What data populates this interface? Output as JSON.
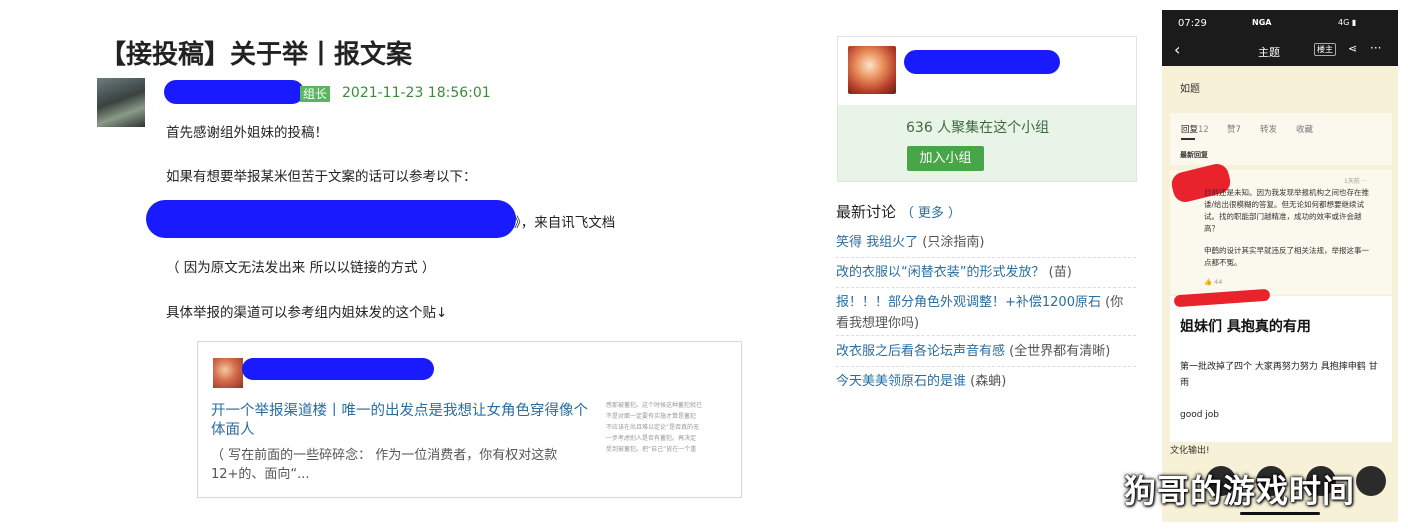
{
  "post": {
    "title": "【接投稿】关于举丨报文案",
    "badge": "组长",
    "date": "2021-11-23 18:56:01",
    "paragraphs": [
      "首先感谢组外姐妹的投稿！",
      "如果有想要举报某米但苦于文案的话可以参考以下：",
      "》，来自讯飞文档",
      "（ 因为原文无法发出来 所以以链接的方式 ）",
      "具体举报的渠道可以参考组内姐妹发的这个贴↓"
    ]
  },
  "embed": {
    "title": "开一个举报渠道楼丨唯一的出发点是我想让女角色穿得像个体面人",
    "desc": "（ 写在前面的一些碎碎念： 作为一位消费者，你有权对这款12+的、面向“...",
    "side_lines": [
      "感那被蓄犯。这个时候这种蓄犯就已",
      "不是对面一定要有实施才算是蓄犯",
      "",
      "不应该在尚且难以定论“是否真的无",
      "一步考虑别人是否有蓄犯。再决定",
      "受到被蓄犯。把“自己”放在一个重"
    ]
  },
  "group": {
    "count": "636 人聚集在这个小组",
    "join_label": "加入小组"
  },
  "discussions": {
    "heading": "最新讨论",
    "more": "（ 更多 ）",
    "items": [
      {
        "title": "笑得 我组火了",
        "author": "(只涂指南)"
      },
      {
        "title": "改的衣服以“闲替衣装”的形式发放？",
        "author": "(苗)"
      },
      {
        "title": "报！！！部分角色外观调整！+补偿1200原石",
        "author": "(你看我想理你吗)"
      },
      {
        "title": "改衣服之后看各论坛声音有感",
        "author": "(全世界都有清晰)"
      },
      {
        "title": "今天美美领原石的是谁",
        "author": "(森蚺)"
      }
    ]
  },
  "phone": {
    "time": "07:29",
    "app_badge": "NGA",
    "signal": "4G",
    "back_icon": "chevron-left-icon",
    "title": "主题",
    "host_label": "楼主",
    "body": "如题",
    "tabs": [
      {
        "label": "回复",
        "count": "12"
      },
      {
        "label": "赞",
        "count": "7"
      },
      {
        "label": "转发",
        "count": ""
      },
      {
        "label": "收藏",
        "count": ""
      }
    ],
    "latest_label": "最新回复",
    "reply_meta": "1天前",
    "reply_text": "目前还是未知。因为我发现举报机构之间也存在推诿/给出很模糊的答复。但无论如何都想要继续试试。找的职能部门越精准，成功的效率或许会越高？",
    "reply_text2": "申鹤的设计其实早就违反了相关法规，举报这事一点都不冤。",
    "like_count": "44",
    "card_title": "姐妹们 具抱真的有用",
    "card_body": "第一批改掉了四个 大家再努力努力 具抱摔申鹤 甘雨",
    "card_foot": "good job",
    "footer": "文化输出!"
  },
  "watermark": "狗哥的游戏时间",
  "colors": {
    "link": "#2a6d9e",
    "date_green": "#3b8d3b",
    "join_green": "#48a648",
    "group_bg": "#e9f4e9",
    "redact_blue": "#1a1aff",
    "redact_red": "#e8232c"
  }
}
